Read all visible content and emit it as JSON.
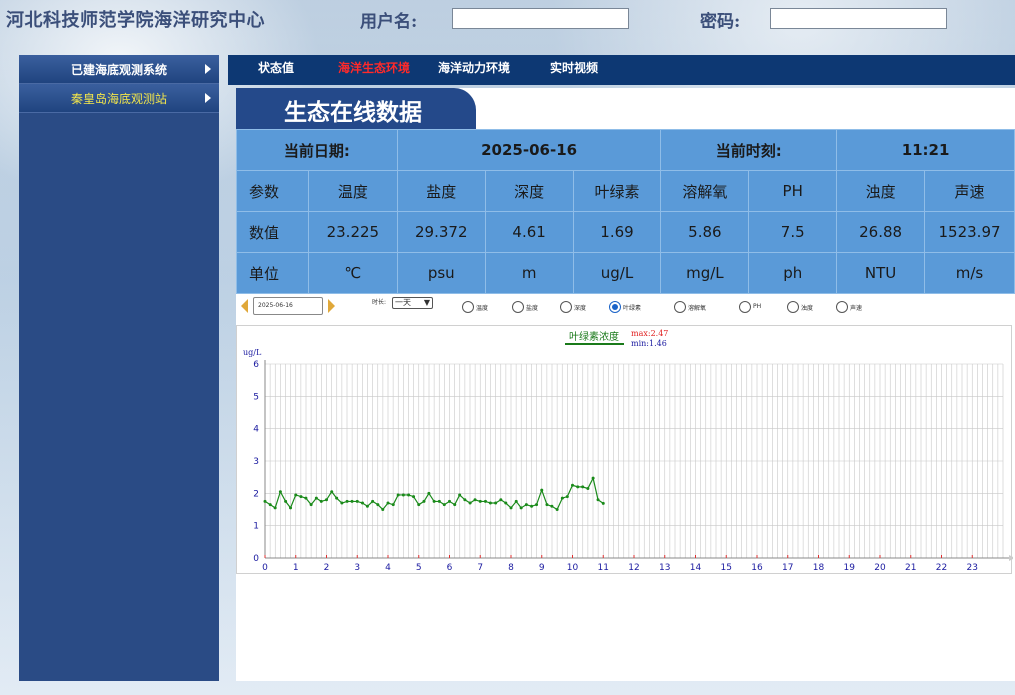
{
  "header": {
    "org_title": "河北科技师范学院海洋研究中心",
    "username_label": "用户名:",
    "username_value": "",
    "password_label": "密码:",
    "password_value": ""
  },
  "sidebar": {
    "items": [
      {
        "label": "已建海底观测系统"
      },
      {
        "label": "秦皇岛海底观测站"
      }
    ]
  },
  "nav": {
    "tabs": [
      {
        "label": "状态值",
        "active": false
      },
      {
        "label": "海洋生态环境",
        "active": true
      },
      {
        "label": "海洋动力环境",
        "active": false
      },
      {
        "label": "实时视频",
        "active": false
      }
    ]
  },
  "section": {
    "title": "生态在线数据"
  },
  "table": {
    "date_label": "当前日期:",
    "date_value": "2025-06-16",
    "time_label": "当前时刻:",
    "time_value": "11:21",
    "param_row": [
      "参数",
      "温度",
      "盐度",
      "深度",
      "叶绿素",
      "溶解氧",
      "PH",
      "浊度",
      "声速"
    ],
    "value_row": [
      "数值",
      "23.225",
      "29.372",
      "4.61",
      "1.69",
      "5.86",
      "7.5",
      "26.88",
      "1523.97"
    ],
    "unit_row": [
      "单位",
      "℃",
      "psu",
      "m",
      "ug/L",
      "mg/L",
      "ph",
      "NTU",
      "m/s"
    ]
  },
  "controls": {
    "date_value": "2025-06-16",
    "duration_label": "时长:",
    "duration_value": "一天",
    "radios": [
      {
        "label": "温度",
        "checked": false
      },
      {
        "label": "盐度",
        "checked": false
      },
      {
        "label": "深度",
        "checked": false
      },
      {
        "label": "叶绿素",
        "checked": true
      },
      {
        "label": "溶解氧",
        "checked": false
      },
      {
        "label": "PH",
        "checked": false
      },
      {
        "label": "浊度",
        "checked": false
      },
      {
        "label": "声速",
        "checked": false
      }
    ]
  },
  "chart_data": {
    "type": "line",
    "title": "叶绿素浓度",
    "max_label": "max:2.47",
    "min_label": "min:1.46",
    "ylabel": "ug/L",
    "xlabel": "",
    "xlim": [
      0,
      24
    ],
    "ylim": [
      0,
      6
    ],
    "x_ticks": [
      "0",
      "1",
      "2",
      "3",
      "4",
      "5",
      "6",
      "7",
      "8",
      "9",
      "10",
      "11",
      "12",
      "13",
      "14",
      "15",
      "16",
      "17",
      "18",
      "19",
      "20",
      "21",
      "22",
      "23"
    ],
    "y_ticks": [
      "0",
      "1",
      "2",
      "3",
      "4",
      "5",
      "6"
    ],
    "line_color": "#1a8a1a",
    "x": [
      0.0,
      0.17,
      0.33,
      0.5,
      0.67,
      0.83,
      1.0,
      1.17,
      1.33,
      1.5,
      1.67,
      1.83,
      2.0,
      2.17,
      2.33,
      2.5,
      2.67,
      2.83,
      3.0,
      3.17,
      3.33,
      3.5,
      3.67,
      3.83,
      4.0,
      4.17,
      4.33,
      4.5,
      4.67,
      4.83,
      5.0,
      5.17,
      5.33,
      5.5,
      5.67,
      5.83,
      6.0,
      6.17,
      6.33,
      6.5,
      6.67,
      6.83,
      7.0,
      7.17,
      7.33,
      7.5,
      7.67,
      7.83,
      8.0,
      8.17,
      8.33,
      8.5,
      8.67,
      8.83,
      9.0,
      9.17,
      9.33,
      9.5,
      9.67,
      9.83,
      10.0,
      10.17,
      10.33,
      10.5,
      10.67,
      10.83,
      11.0
    ],
    "y": [
      1.75,
      1.65,
      1.55,
      2.05,
      1.75,
      1.55,
      1.95,
      1.9,
      1.85,
      1.65,
      1.85,
      1.75,
      1.8,
      2.05,
      1.85,
      1.7,
      1.75,
      1.75,
      1.75,
      1.7,
      1.6,
      1.75,
      1.65,
      1.5,
      1.7,
      1.65,
      1.95,
      1.95,
      1.95,
      1.9,
      1.65,
      1.75,
      2.0,
      1.75,
      1.75,
      1.65,
      1.75,
      1.65,
      1.95,
      1.8,
      1.7,
      1.8,
      1.75,
      1.75,
      1.7,
      1.7,
      1.8,
      1.7,
      1.55,
      1.75,
      1.55,
      1.65,
      1.6,
      1.65,
      2.1,
      1.65,
      1.6,
      1.5,
      1.85,
      1.9,
      2.25,
      2.2,
      2.2,
      2.15,
      2.47,
      1.8,
      1.69
    ]
  }
}
